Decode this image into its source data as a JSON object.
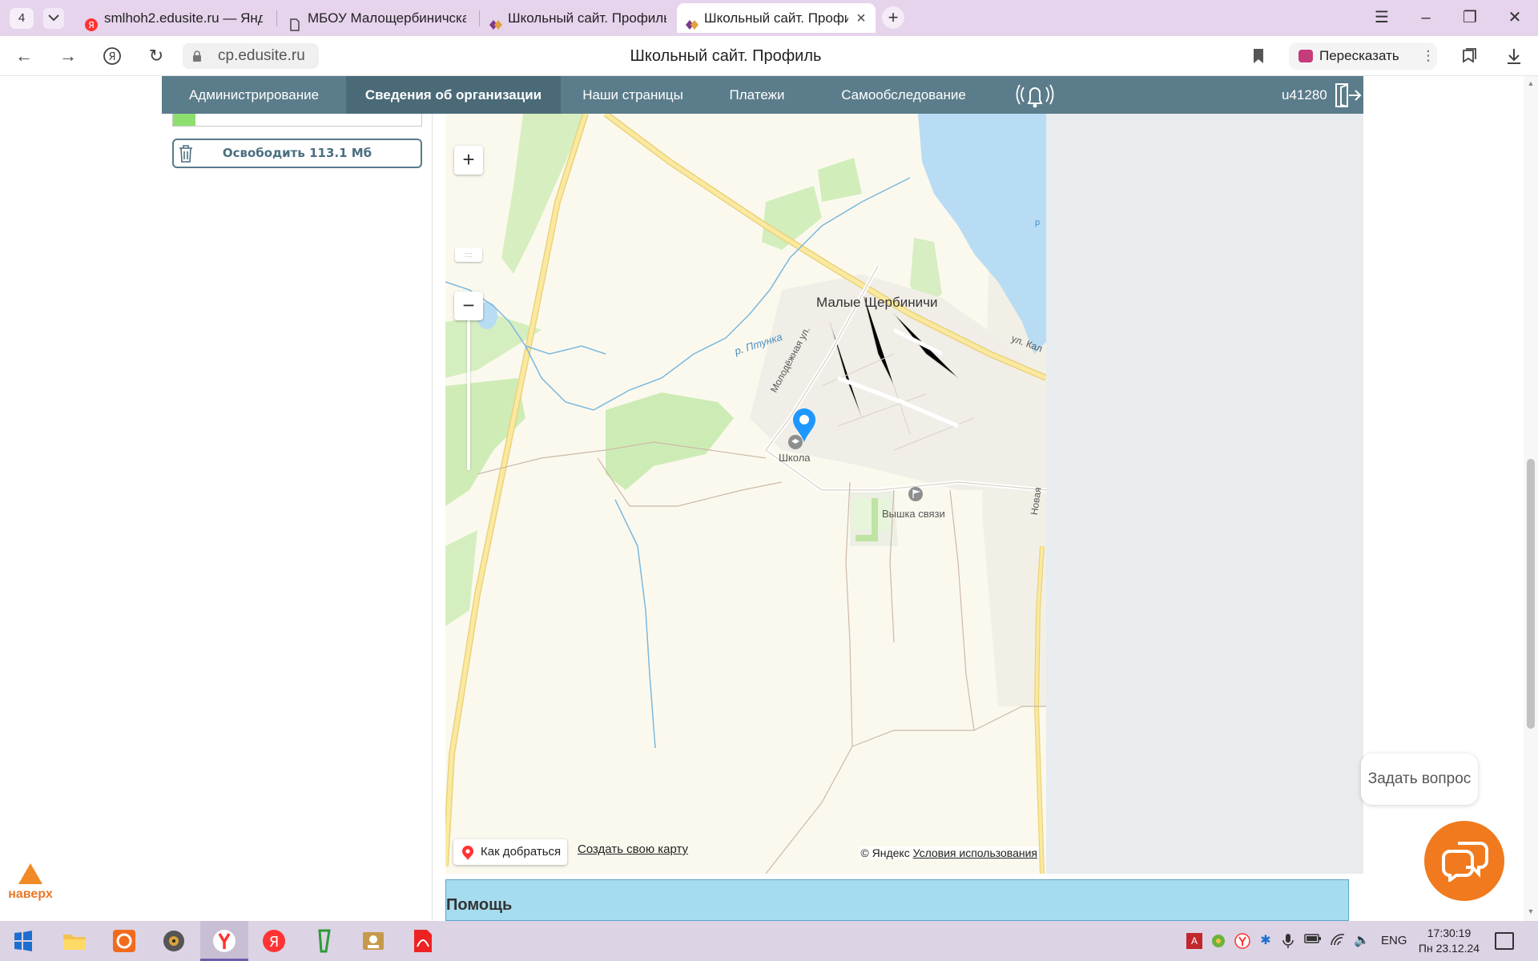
{
  "browser": {
    "tab_count": "4",
    "tabs": [
      {
        "title": "smlhoh2.edusite.ru — Янд",
        "favicon": "yandex-icon"
      },
      {
        "title": "МБОУ Малощербиничска",
        "favicon": "document-icon"
      },
      {
        "title": "Школьный сайт. Профиль",
        "favicon": "edusite-icon"
      },
      {
        "title": "Школьный сайт. Профи",
        "favicon": "edusite-icon",
        "active": true
      }
    ],
    "new_tab": "+",
    "url": "cp.edusite.ru",
    "page_title": "Школьный сайт. Профиль",
    "retell_label": "Пересказать"
  },
  "site_menu": {
    "items": [
      {
        "label": "Администрирование"
      },
      {
        "label": "Сведения об организации",
        "active": true
      },
      {
        "label": "Наши страницы"
      },
      {
        "label": "Платежи"
      },
      {
        "label": "Самообследование"
      }
    ],
    "user_id": "u41280"
  },
  "sidebar": {
    "quota_fraction": 0.09,
    "free_button_label": "Освободить 113.1 Мб"
  },
  "map": {
    "labels": {
      "village": "Малые Щербиничи",
      "river": "р. Птунка",
      "street_molodezhnaya": "Молодёжная ул.",
      "street_kal": "ул. Кал",
      "street_novaya": "Новая",
      "river_edge": "р",
      "school": "Школа",
      "tower": "Вышка связи"
    },
    "zoom_in": "+",
    "zoom_out": "−",
    "zoom_handle": "::::",
    "route_button": "Как добраться",
    "create_map_link": "Создать свою карту",
    "copyright_prefix": "© Яндекс",
    "terms_link": "Условия использования"
  },
  "help": {
    "title": "Помощь"
  },
  "widgets": {
    "to_top_label": "наверх",
    "ask_question": "Задать вопрос"
  },
  "taskbar": {
    "language": "ENG",
    "time": "17:30:19",
    "date": "Пн 23.12.24"
  },
  "colors": {
    "site_menu_bg": "#5b7c8a",
    "site_menu_active": "#4b6a78",
    "accent_orange": "#f07a1d",
    "help_bg": "#a6dcef",
    "tab_strip": "#e6d3ec"
  }
}
